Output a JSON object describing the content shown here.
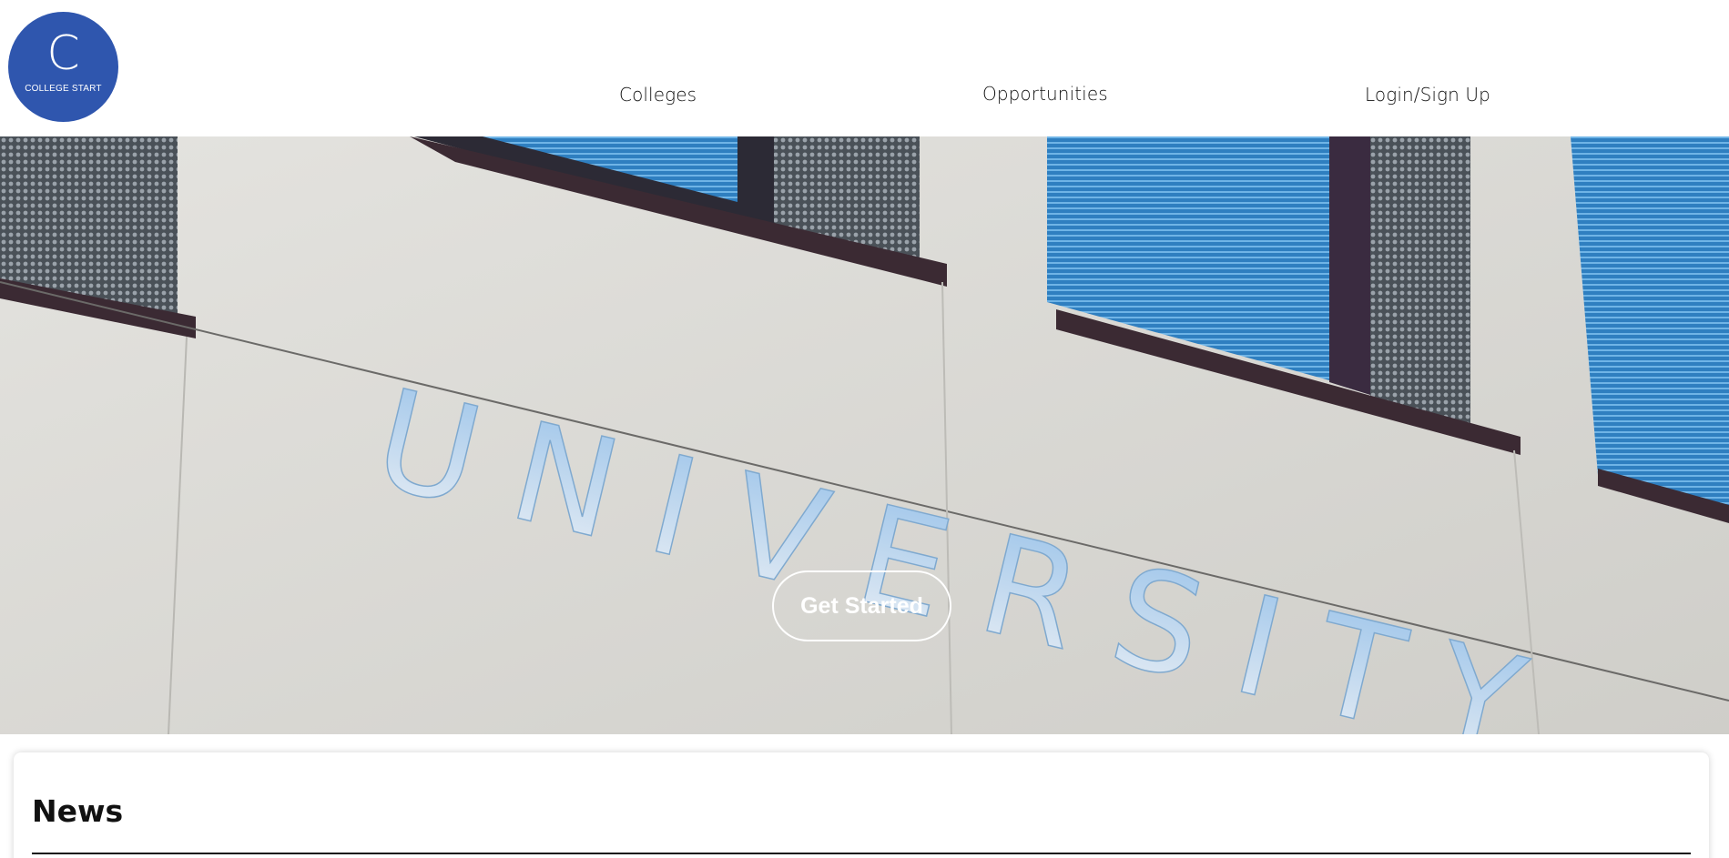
{
  "logo": {
    "letter": "C",
    "text": "COLLEGE START",
    "color": "#2f56ae"
  },
  "nav": {
    "colleges": "Colleges",
    "opportunities": "Opportunities",
    "login": "Login/Sign Up"
  },
  "hero": {
    "cta_label": "Get Started",
    "image_description": "University building facade with UNIVERSITY letters",
    "sign_text": "UNIVERSITY"
  },
  "news": {
    "title": "News"
  }
}
